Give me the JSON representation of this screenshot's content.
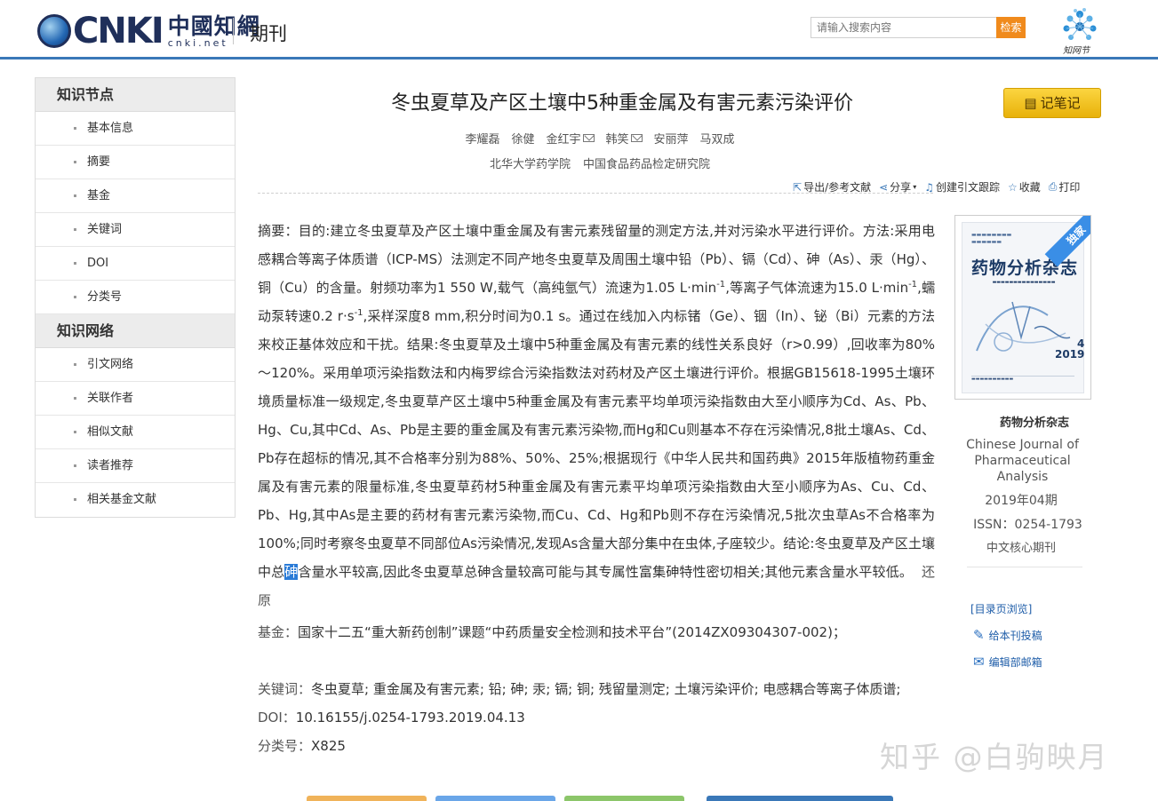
{
  "header": {
    "logo_text": "CNKI",
    "logo_cn": "中國知網",
    "logo_url": "cnki.net",
    "section": "期刊",
    "search_placeholder": "请输入搜索内容",
    "search_button": "检索",
    "zhiwangjie_label": "知网节"
  },
  "sidebar": {
    "groups": [
      {
        "title": "知识节点",
        "items": [
          "基本信息",
          "摘要",
          "基金",
          "关键词",
          "DOI",
          "分类号"
        ]
      },
      {
        "title": "知识网络",
        "items": [
          "引文网络",
          "关联作者",
          "相似文献",
          "读者推荐",
          "相关基金文献"
        ]
      }
    ]
  },
  "article": {
    "title": "冬虫夏草及产区土壤中5种重金属及有害元素污染评价",
    "note_button": "记笔记",
    "authors": [
      {
        "name": "李耀磊",
        "email": false
      },
      {
        "name": "徐健",
        "email": false
      },
      {
        "name": "金红宇",
        "email": true
      },
      {
        "name": "韩笑",
        "email": true
      },
      {
        "name": "安丽萍",
        "email": false
      },
      {
        "name": "马双成",
        "email": false
      }
    ],
    "affiliations": [
      "北华大学药学院",
      "中国食品药品检定研究院"
    ],
    "tools": [
      "导出/参考文献",
      "分享",
      "创建引文跟踪",
      "收藏",
      "打印"
    ],
    "abstract_label": "摘要：",
    "abstract_p1": "目的:建立冬虫夏草及产区土壤中重金属及有害元素残留量的测定方法,并对污染水平进行评价。方法:采用电感耦合等离子体质谱（ICP-MS）法测定不同产地冬虫夏草及周围土壤中铅（Pb）、镉（Cd）、砷（As）、汞（Hg）、铜（Cu）的含量。射频功率为1 550 W,载气（高纯氩气）流速为1.05 L·min",
    "abstract_sup1": "-1",
    "abstract_p2": ",等离子气体流速为15.0 L·min",
    "abstract_sup2": "-1",
    "abstract_p3": ",蠕动泵转速0.2 r·s",
    "abstract_sup3": "-1",
    "abstract_p4": ",采样深度8 mm,积分时间为0.1 s。通过在线加入内标锗（Ge）、铟（In）、铋（Bi）元素的方法来校正基体效应和干扰。结果:冬虫夏草及土壤中5种重金属及有害元素的线性关系良好（r>0.99）,回收率为80%～120%。采用单项污染指数法和内梅罗综合污染指数法对药材及产区土壤进行评价。根据GB15618-1995土壤环境质量标准一级规定,冬虫夏草产区土壤中5种重金属及有害元素平均单项污染指数由大至小顺序为Cd、As、Pb、Hg、Cu,其中Cd、As、Pb是主要的重金属及有害元素污染物,而Hg和Cu则基本不存在污染情况,8批土壤As、Cd、Pb存在超标的情况,其不合格率分别为88%、50%、25%;根据现行《中华人民共和国药典》2015年版植物药重金属及有害元素的限量标准,冬虫夏草药材5种重金属及有害元素平均单项污染指数由大至小顺序为As、Cu、Cd、Pb、Hg,其中As是主要的药材有害元素污染物,而Cu、Cd、Hg和Pb则不存在污染情况,5批次虫草As不合格率为100%;同时考察冬虫夏草不同部位As污染情况,发现As含量大部分集中在虫体,子座较少。结论:冬虫夏草及产区土壤中总",
    "abstract_highlight": "砷",
    "abstract_p5": "含量水平较高,因此冬虫夏草总砷含量较高可能与其专属性富集砷特性密切相关;其他元素含量水平较低。",
    "restore": "还原",
    "fund_label": "基金：",
    "fund": "国家十二五“重大新药创制”课题“中药质量安全检测和技术平台”(2014ZX09304307-002)；",
    "keywords_label": "关键词：",
    "keywords": "冬虫夏草; 重金属及有害元素; 铅; 砷; 汞; 镉; 铜; 残留量测定; 土壤污染评价; 电感耦合等离子体质谱;",
    "doi_label": "DOI：",
    "doi": "10.16155/j.0254-1793.2019.04.13",
    "class_label": "分类号：",
    "class": "X825"
  },
  "journal": {
    "ribbon": "独家",
    "cover_title": "药物分析杂志",
    "cover_issue": "4",
    "cover_year": "2019",
    "name_cn": "药物分析杂志",
    "name_en": "Chinese Journal of Pharmaceutical Analysis",
    "issue": "2019年04期",
    "issn": "ISSN：0254-1793",
    "core": "中文核心期刊",
    "links": [
      "[目录页浏览]",
      "给本刊投稿",
      "编辑部邮箱"
    ]
  },
  "watermark": "知乎 @白驹映月",
  "colors": {
    "header_line": "#3a78b8",
    "search_button": "#f08a1c",
    "note_button": "#f2c12a",
    "link": "#1d5ca8",
    "highlight": "#2a7bd7"
  }
}
